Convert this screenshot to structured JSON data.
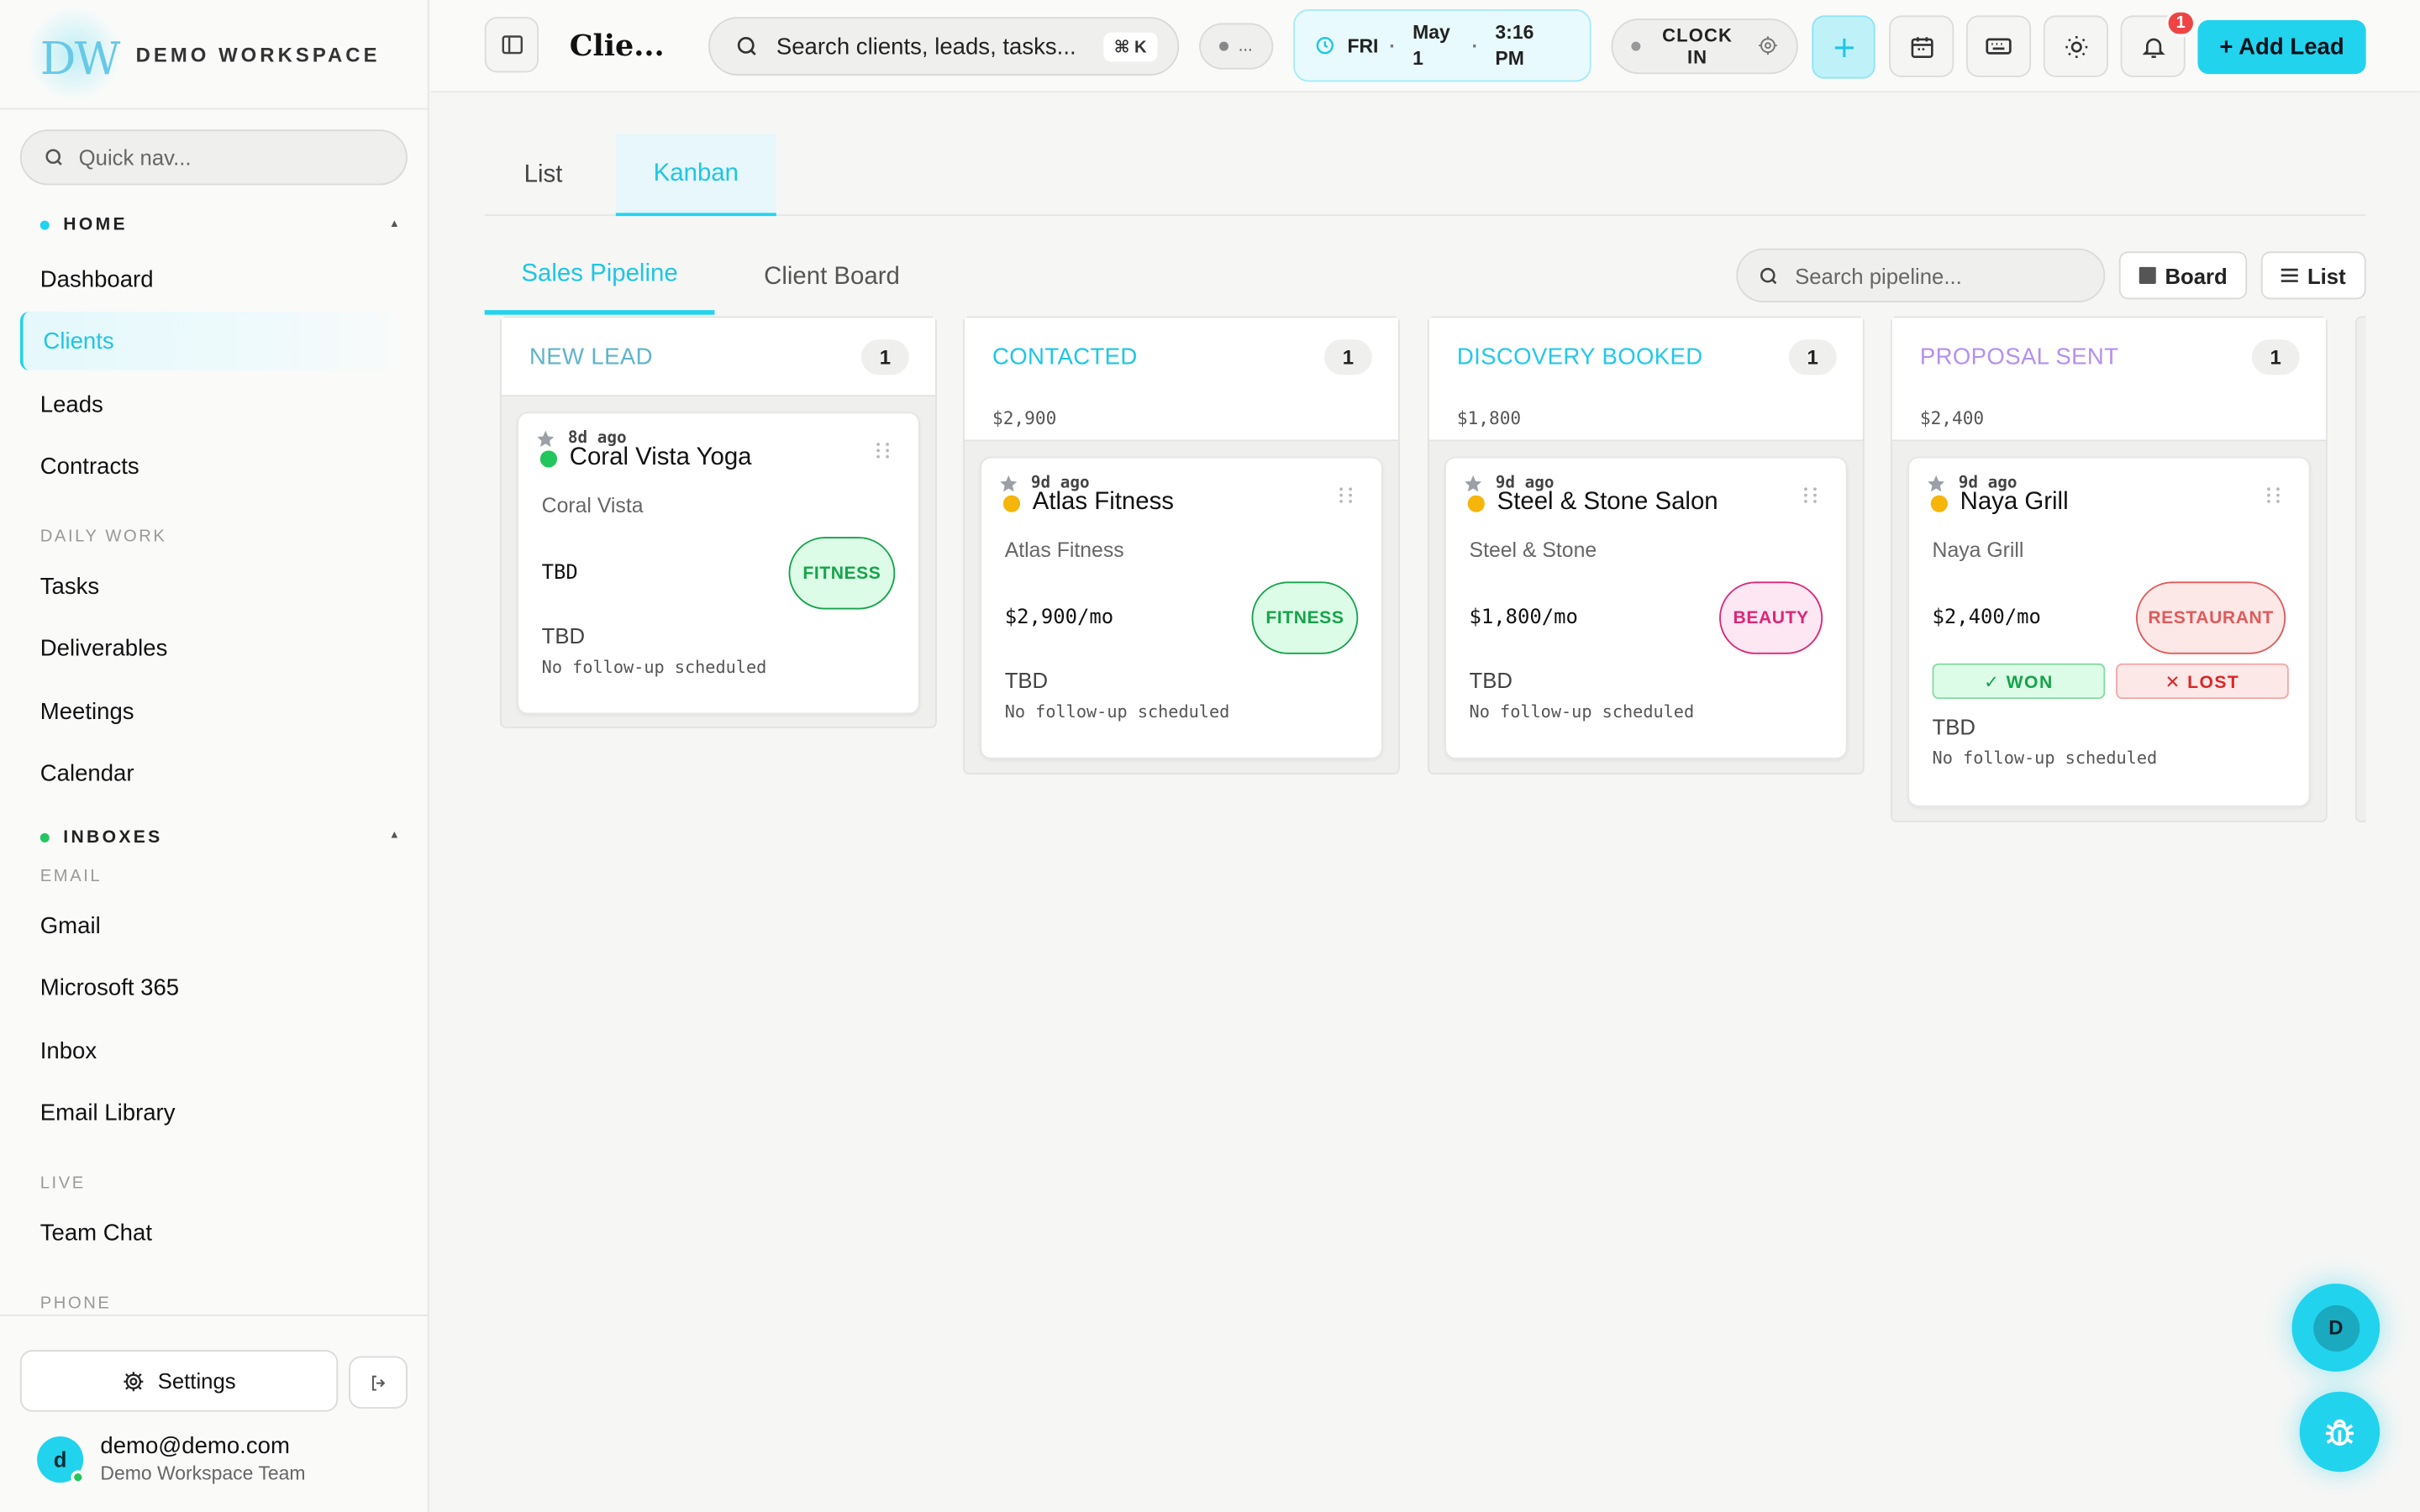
{
  "workspace": {
    "logo_text": "DW",
    "name": "DEMO WORKSPACE"
  },
  "sidebar": {
    "quick_nav_placeholder": "Quick nav...",
    "home_section": "HOME",
    "home_items": [
      {
        "label": "Dashboard"
      },
      {
        "label": "Clients",
        "active": true
      },
      {
        "label": "Leads"
      },
      {
        "label": "Contracts"
      }
    ],
    "daily_work_label": "DAILY WORK",
    "daily_items": [
      {
        "label": "Tasks"
      },
      {
        "label": "Deliverables"
      },
      {
        "label": "Meetings"
      },
      {
        "label": "Calendar"
      }
    ],
    "inboxes_section": "INBOXES",
    "email_label": "EMAIL",
    "email_items": [
      {
        "label": "Gmail"
      },
      {
        "label": "Microsoft 365"
      },
      {
        "label": "Inbox"
      },
      {
        "label": "Email Library"
      }
    ],
    "live_label": "LIVE",
    "live_items": [
      {
        "label": "Team Chat"
      }
    ],
    "phone_label": "PHONE",
    "settings_label": "Settings",
    "user": {
      "initial": "d",
      "email": "demo@demo.com",
      "team": "Demo Workspace Team"
    }
  },
  "topbar": {
    "page_title": "Clie...",
    "search_placeholder": "Search clients, leads, tasks...",
    "search_shortcut": "⌘ K",
    "status_text": "...",
    "clock": {
      "day": "FRI",
      "date_line1": "May",
      "date_line2": "1",
      "time_line1": "3:16",
      "time_line2": "PM"
    },
    "clock_in_line1": "CLOCK",
    "clock_in_line2": "IN",
    "notification_count": "1",
    "add_lead_label": "+ Add Lead"
  },
  "view_tabs": [
    {
      "label": "List"
    },
    {
      "label": "Kanban",
      "active": true
    }
  ],
  "pipeline_tabs": [
    {
      "label": "Sales Pipeline",
      "active": true
    },
    {
      "label": "Client Board"
    }
  ],
  "pipeline_search_placeholder": "Search pipeline...",
  "board_button": "Board",
  "list_button": "List",
  "columns": [
    {
      "title": "NEW LEAD",
      "count": "1",
      "total": "",
      "color": "#5fb3c9",
      "cards": [
        {
          "ago": "8d ago",
          "name": "Coral Vista Yoga",
          "status_color": "#22c55e",
          "company": "Coral Vista",
          "amount": "TBD",
          "tag": "FITNESS",
          "next": "TBD",
          "follow_up": "No follow-up scheduled"
        }
      ]
    },
    {
      "title": "CONTACTED",
      "count": "1",
      "total": "$2,900",
      "color": "#1ec6e4",
      "cards": [
        {
          "ago": "9d ago",
          "name": "Atlas Fitness",
          "status_color": "#f5b50a",
          "company": "Atlas Fitness",
          "amount": "$2,900/mo",
          "tag": "FITNESS",
          "next": "TBD",
          "follow_up": "No follow-up scheduled"
        }
      ]
    },
    {
      "title": "DISCOVERY BOOKED",
      "count": "1",
      "total": "$1,800",
      "color": "#22c8ea",
      "cards": [
        {
          "ago": "9d ago",
          "name": "Steel & Stone Salon",
          "status_color": "#f5b50a",
          "company": "Steel & Stone",
          "amount": "$1,800/mo",
          "tag": "BEAUTY",
          "next": "TBD",
          "follow_up": "No follow-up scheduled"
        }
      ]
    },
    {
      "title": "PROPOSAL SENT",
      "count": "1",
      "total": "$2,400",
      "color": "#b48ff0",
      "cards": [
        {
          "ago": "9d ago",
          "name": "Naya Grill",
          "status_color": "#f5b50a",
          "company": "Naya Grill",
          "amount": "$2,400/mo",
          "tag": "RESTAURANT",
          "won_label": "✓ WON",
          "lost_label": "✕ LOST",
          "next": "TBD",
          "follow_up": "No follow-up scheduled"
        }
      ]
    }
  ],
  "fab": {
    "avatar_initial": "D"
  },
  "colors": {
    "accent": "#22d3ee",
    "fitness": "#16a34a",
    "beauty": "#db2777",
    "restaurant": "#e05a5a",
    "badge": "#ef4444"
  }
}
